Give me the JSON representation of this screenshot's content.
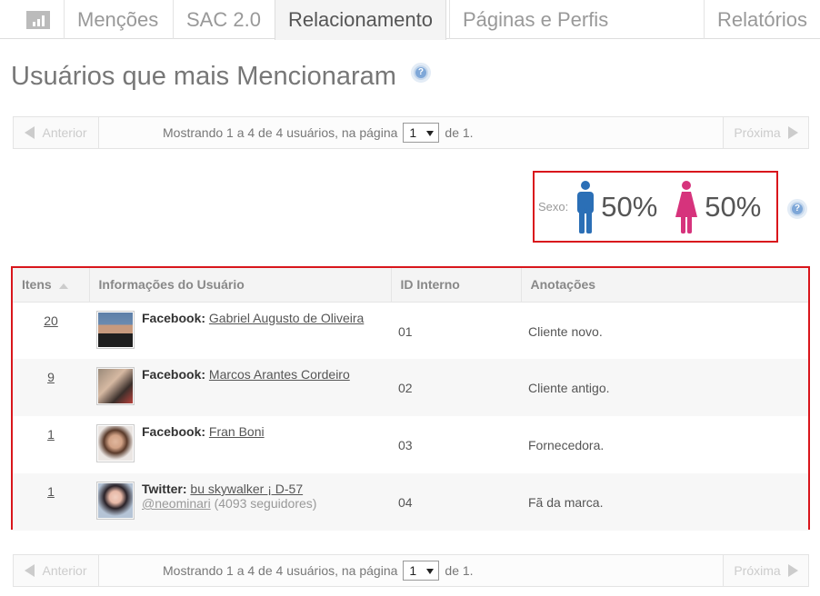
{
  "tabs": [
    {
      "label": "Menções"
    },
    {
      "label": "SAC 2.0"
    },
    {
      "label": "Relacionamento"
    },
    {
      "label": "Páginas e Perfis"
    },
    {
      "label": "Relatórios"
    }
  ],
  "page_title": "Usuários que mais Mencionaram",
  "help_glyph": "?",
  "pager": {
    "prev_label": "Anterior",
    "next_label": "Próxima",
    "info_before": "Mostrando 1 a 4 de 4 usuários, na página",
    "page_value": "1",
    "info_after": "de 1."
  },
  "gender": {
    "label": "Sexo:",
    "male_pct": "50%",
    "female_pct": "50%",
    "male_color": "#2b6fb6",
    "female_color": "#d6337c"
  },
  "table": {
    "headers": [
      "Itens",
      "Informações do Usuário",
      "ID Interno",
      "Anotações"
    ],
    "rows": [
      {
        "items": "20",
        "network": "Facebook:",
        "name": "Gabriel Augusto de Oliveira",
        "id": "01",
        "note": "Cliente novo."
      },
      {
        "items": "9",
        "network": "Facebook:",
        "name": "Marcos Arantes Cordeiro",
        "id": "02",
        "note": "Cliente antigo."
      },
      {
        "items": "1",
        "network": "Facebook:",
        "name": "Fran Boni",
        "id": "03",
        "note": "Fornecedora."
      },
      {
        "items": "1",
        "network": "Twitter:",
        "name": "bu skywalker ¡ D-57",
        "handle": "@neominari",
        "followers": "(4093 seguidores)",
        "id": "04",
        "note": "Fã da marca."
      }
    ]
  }
}
